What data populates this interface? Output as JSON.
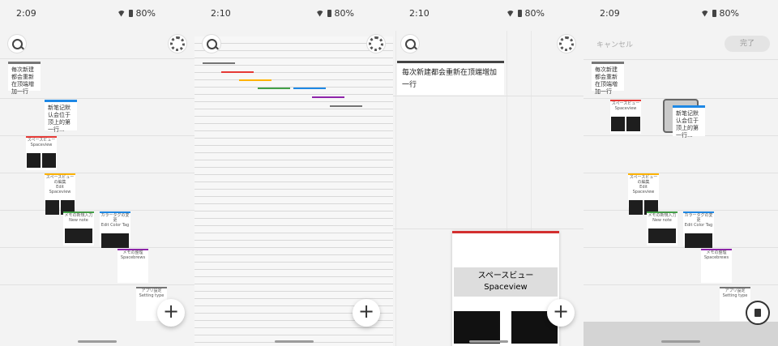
{
  "panels": [
    {
      "time": "2:09",
      "battery": "80%"
    },
    {
      "time": "2:10",
      "battery": "80%"
    },
    {
      "time": "2:10",
      "battery": "80%"
    },
    {
      "time": "2:09",
      "battery": "80%"
    }
  ],
  "note_card": "毎次新建都会重新在顶端増加一行",
  "note_card2": "新笔记默认会位于顶上的第一行...",
  "label_spaceview_jp": "スペースビュー",
  "label_spaceview_en": "Spaceview",
  "label_edit_jp": "スペースビューの編集",
  "label_edit_en": "Edit Spaceview",
  "label_newnote_jp": "メモの新規入力",
  "label_newnote_en": "New note",
  "label_color_jp": "カラータグの変更",
  "label_color_en": "Edit Color Tag",
  "label_done_jp": "メモの整理",
  "label_done_en": "Spacebrews",
  "label_sort_jp": "アプリ設定",
  "label_sort_en": "Setting type",
  "popup_jp": "スペースビュー",
  "popup_en": "Spaceview",
  "cancel_label": "キャンセル",
  "done_label": "完了",
  "plus": "+",
  "colors": {
    "red": "#e53935",
    "orange": "#ffb300",
    "green": "#43a047",
    "blue": "#1e88e5",
    "purple": "#8e24aa",
    "gray": "#757575"
  }
}
